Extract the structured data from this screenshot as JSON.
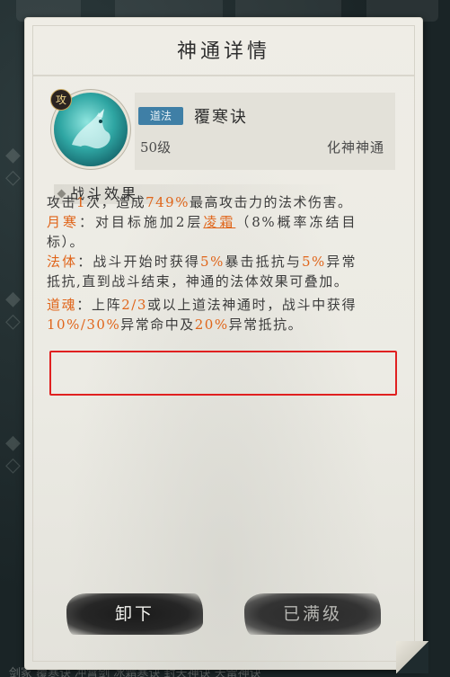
{
  "window": {
    "title": "神通详情"
  },
  "skill": {
    "badge": "攻",
    "icon": "water-dragon-icon",
    "type_tag": "道法",
    "name": "覆寒诀",
    "level": "50级",
    "category": "化神神通"
  },
  "section": {
    "title": "战斗效果"
  },
  "effects": [
    {
      "parts": [
        {
          "text": "攻击",
          "hl": false
        },
        {
          "text": "1",
          "hl": true
        },
        {
          "text": "次，造成",
          "hl": false
        },
        {
          "text": "749%",
          "hl": true
        },
        {
          "text": "最高攻击力的法术伤害。",
          "hl": false
        }
      ]
    },
    {
      "parts": [
        {
          "text": "月寒",
          "hl": true
        },
        {
          "text": "：对目标施加2层",
          "hl": false
        },
        {
          "text": "凌霜",
          "hl": true,
          "underline": true
        },
        {
          "text": "（8%概率冻结目标）。",
          "hl": false
        }
      ]
    },
    {
      "parts": [
        {
          "text": "法体",
          "hl": true
        },
        {
          "text": "：战斗开始时获得",
          "hl": false
        },
        {
          "text": "5%",
          "hl": true
        },
        {
          "text": "暴击抵抗与",
          "hl": false
        },
        {
          "text": "5%",
          "hl": true
        },
        {
          "text": "异常抵抗,直到战斗结束，神通的法体效果可叠加。",
          "hl": false
        }
      ]
    },
    {
      "parts": [
        {
          "text": "道魂",
          "hl": true
        },
        {
          "text": "：上阵",
          "hl": false
        },
        {
          "text": "2/3",
          "hl": true
        },
        {
          "text": "或以上道法神通时，战斗中获得",
          "hl": false
        },
        {
          "text": "10%/30%",
          "hl": true
        },
        {
          "text": "异常命中及",
          "hl": false
        },
        {
          "text": "20%",
          "hl": true
        },
        {
          "text": "异常抵抗。",
          "hl": false
        }
      ]
    }
  ],
  "buttons": {
    "unequip": "卸下",
    "maxed": "已满级"
  },
  "background": {
    "bottom_strip": "剑冢  覆寒诀  冲霄剑  冰霜寒诀  封天神诀  天雷神诀"
  },
  "colors": {
    "highlight": "#e0651a",
    "tag": "#3f7fa6",
    "annotation_box": "#e02020"
  }
}
